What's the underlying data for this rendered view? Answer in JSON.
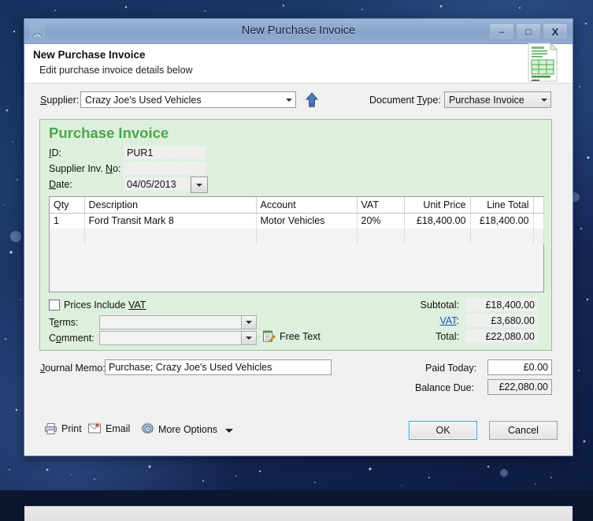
{
  "window": {
    "title": "New Purchase Invoice",
    "app_icon": "app-dome-icon",
    "minimize_label": "–",
    "maximize_label": "□",
    "close_label": "X"
  },
  "header": {
    "heading": "New Purchase Invoice",
    "subheading": "Edit purchase invoice details below",
    "icon": "invoice-document-icon"
  },
  "top_row": {
    "supplier_label": "Supplier:",
    "supplier_value": "Crazy Joe's Used Vehicles",
    "drill_up_icon": "blue-up-arrow-icon",
    "document_type_label": "Document Type:",
    "document_type_value": "Purchase Invoice"
  },
  "invoice": {
    "heading": "Purchase Invoice",
    "id_label": "ID:",
    "id_value": "PUR1",
    "supplier_inv_no_label": "Supplier Inv. No:",
    "supplier_inv_no_value": "",
    "date_label": "Date:",
    "date_value": "04/05/2013",
    "date_picker_icon": "calendar-dropdown-icon"
  },
  "items": {
    "columns": [
      "Qty",
      "Description",
      "Account",
      "VAT",
      "Unit Price",
      "Line Total"
    ],
    "rows": [
      {
        "qty": "1",
        "description": "Ford Transit Mark 8",
        "account": "Motor Vehicles",
        "vat": "20%",
        "unit_price": "£18,400.00",
        "line_total": "£18,400.00"
      }
    ]
  },
  "options": {
    "prices_include_vat_label": "Prices Include VAT",
    "prices_include_vat_checked": false,
    "terms_label": "Terms:",
    "terms_value": "",
    "comment_label": "Comment:",
    "comment_value": "",
    "free_text_label": "Free Text",
    "free_text_icon": "notepad-pencil-icon"
  },
  "totals": {
    "subtotal_label": "Subtotal:",
    "subtotal_value": "£18,400.00",
    "vat_label": "VAT:",
    "vat_value": "£3,680.00",
    "total_label": "Total:",
    "total_value": "£22,080.00"
  },
  "payment": {
    "journal_memo_label": "Journal Memo:",
    "journal_memo_value": "Purchase; Crazy Joe's Used Vehicles",
    "paid_today_label": "Paid Today:",
    "paid_today_value": "£0.00",
    "balance_due_label": "Balance Due:",
    "balance_due_value": "£22,080.00"
  },
  "footer": {
    "print_label": "Print",
    "print_icon": "printer-icon",
    "email_label": "Email",
    "email_icon": "envelope-icon",
    "more_options_label": "More Options",
    "more_options_icon": "gear-icon",
    "more_options_caret": "chevron-down-icon",
    "ok_label": "OK",
    "cancel_label": "Cancel"
  },
  "colors": {
    "panel_green": "#ddefdd",
    "heading_green": "#4ca64c",
    "link_blue": "#1b53b0",
    "titlebar_blue": "#8ba6cd",
    "ok_focus_blue": "#3c9fdc"
  }
}
